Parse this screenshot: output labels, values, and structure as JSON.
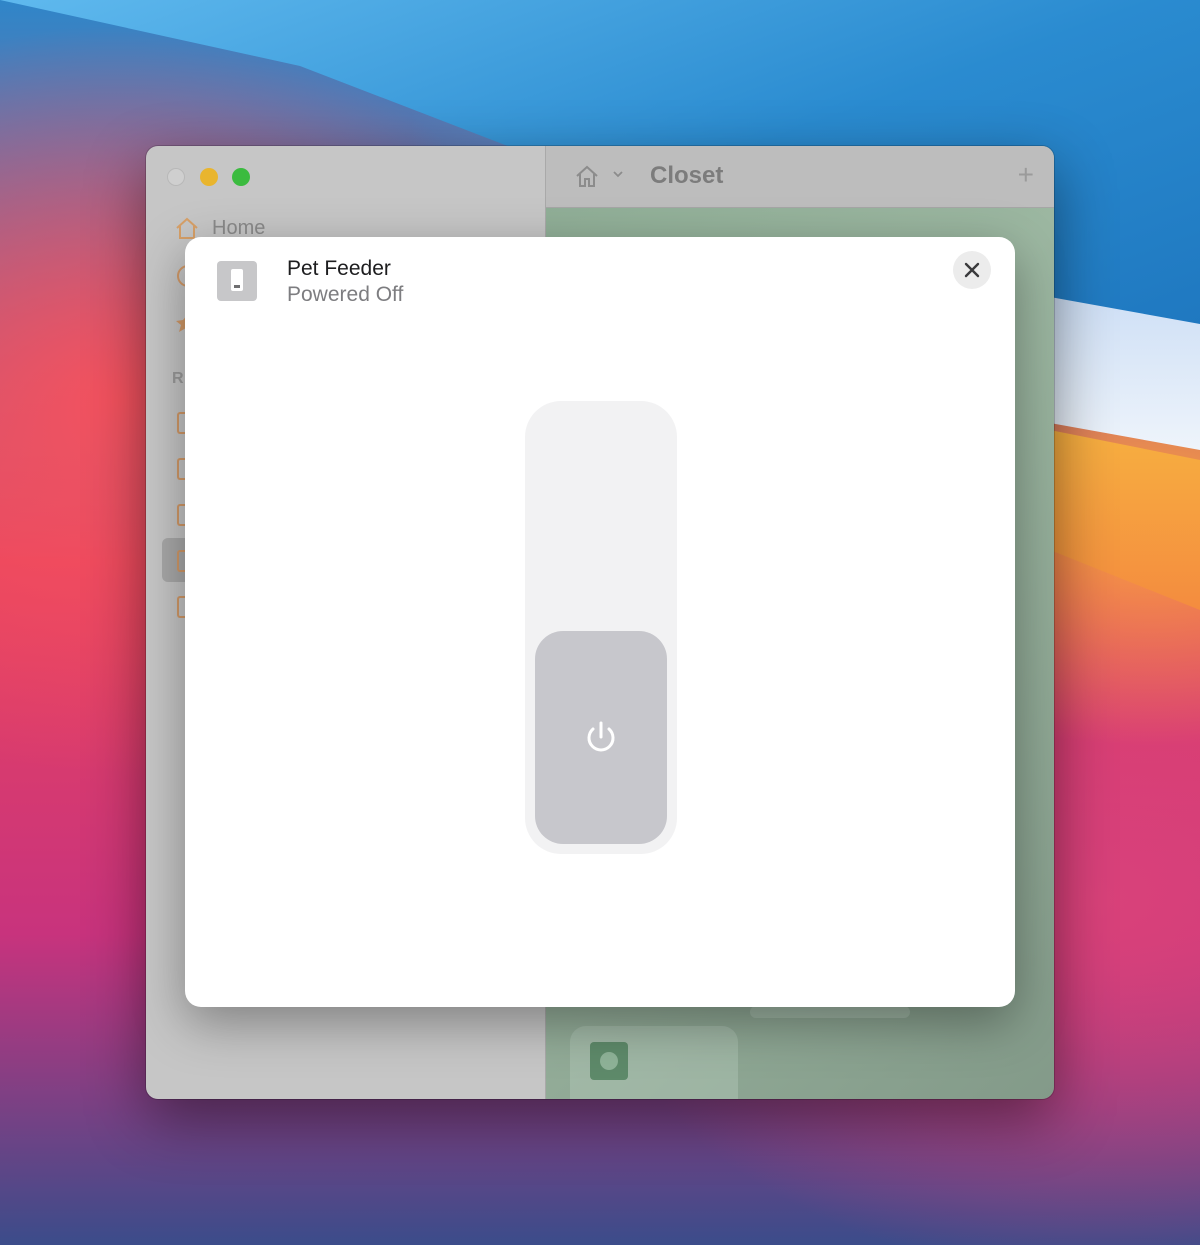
{
  "sidebar": {
    "home_label": "Home",
    "section_label": "R"
  },
  "toolbar": {
    "title": "Closet",
    "plus_label": "+"
  },
  "accessory": {
    "name": "Pet Feeder",
    "status": "Powered Off",
    "icon": "switch-icon"
  },
  "power_control": {
    "icon": "power-icon",
    "state": "off"
  },
  "close_control": {
    "icon": "close-icon"
  },
  "colors": {
    "knob": "#c7c7cc",
    "track": "#f2f2f3",
    "sidebar_accent": "#d39a68"
  }
}
